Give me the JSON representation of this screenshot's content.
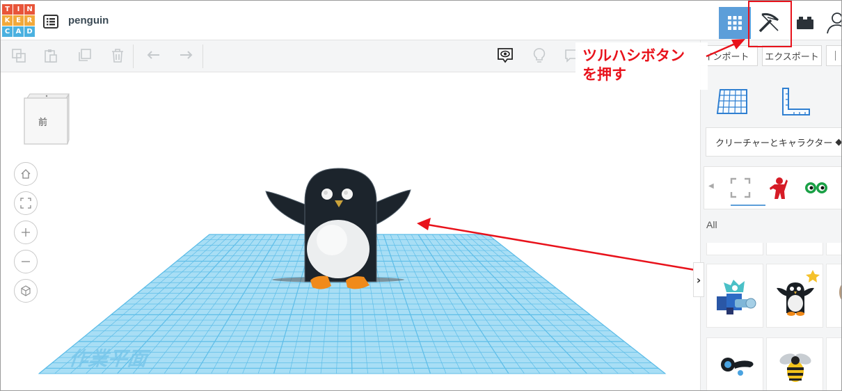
{
  "header": {
    "logo_letters": [
      "T",
      "I",
      "N",
      "K",
      "E",
      "R",
      "C",
      "A",
      "D"
    ],
    "logo_colors": [
      "#e8553a",
      "#e8553a",
      "#e8553a",
      "#f2a93b",
      "#f2a93b",
      "#f2a93b",
      "#4bb1e0",
      "#4bb1e0",
      "#4bb1e0"
    ],
    "project_name": "penguin",
    "view_buttons": [
      "grid-view-icon",
      "pickaxe-icon",
      "brick-icon",
      "user-icon"
    ]
  },
  "toolbar": {
    "left_tools": [
      "copy-icon",
      "paste-icon",
      "duplicate-icon",
      "delete-icon",
      "undo-icon",
      "redo-icon"
    ],
    "right_tools": [
      "show-all-icon",
      "light-bulb-icon",
      "note-icon"
    ]
  },
  "panel": {
    "import_label": "インポート",
    "export_label": "エクスポート",
    "workplane_icons": [
      "workplane-grid-icon",
      "ruler-icon"
    ],
    "category_label": "クリーチャーとキャラクター",
    "tabs": [
      "select-all-icon",
      "red-figure-icon",
      "eyes-icon"
    ],
    "filter_label": "All",
    "items": [
      "robot-shape",
      "penguin-shape",
      "goggles-shape",
      "bee-shape"
    ]
  },
  "viewport": {
    "viewcube_label": "前",
    "workplane_label": "作業平面",
    "nav_buttons": [
      "home-icon",
      "fit-view-icon",
      "zoom-in-icon",
      "zoom-out-icon",
      "ortho-view-icon"
    ]
  },
  "annotation": {
    "line1": "ツルハシボタン",
    "line2": "を押す",
    "color": "#e8121b"
  },
  "colors": {
    "accent": "#5c9ed9",
    "workplane": "#8fd3f0",
    "grid_line": "#4fb7e6"
  }
}
